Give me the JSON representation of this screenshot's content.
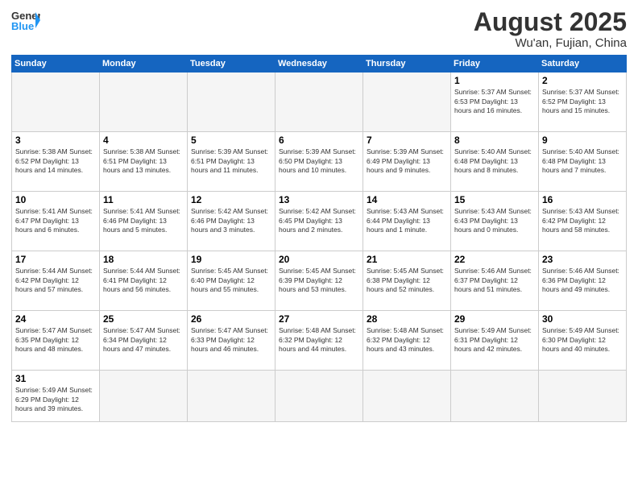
{
  "header": {
    "logo_general": "General",
    "logo_blue": "Blue",
    "title": "August 2025",
    "subtitle": "Wu'an, Fujian, China"
  },
  "days_of_week": [
    "Sunday",
    "Monday",
    "Tuesday",
    "Wednesday",
    "Thursday",
    "Friday",
    "Saturday"
  ],
  "weeks": [
    [
      {
        "day": "",
        "info": ""
      },
      {
        "day": "",
        "info": ""
      },
      {
        "day": "",
        "info": ""
      },
      {
        "day": "",
        "info": ""
      },
      {
        "day": "",
        "info": ""
      },
      {
        "day": "1",
        "info": "Sunrise: 5:37 AM\nSunset: 6:53 PM\nDaylight: 13 hours and 16 minutes."
      },
      {
        "day": "2",
        "info": "Sunrise: 5:37 AM\nSunset: 6:52 PM\nDaylight: 13 hours and 15 minutes."
      }
    ],
    [
      {
        "day": "3",
        "info": "Sunrise: 5:38 AM\nSunset: 6:52 PM\nDaylight: 13 hours and 14 minutes."
      },
      {
        "day": "4",
        "info": "Sunrise: 5:38 AM\nSunset: 6:51 PM\nDaylight: 13 hours and 13 minutes."
      },
      {
        "day": "5",
        "info": "Sunrise: 5:39 AM\nSunset: 6:51 PM\nDaylight: 13 hours and 11 minutes."
      },
      {
        "day": "6",
        "info": "Sunrise: 5:39 AM\nSunset: 6:50 PM\nDaylight: 13 hours and 10 minutes."
      },
      {
        "day": "7",
        "info": "Sunrise: 5:39 AM\nSunset: 6:49 PM\nDaylight: 13 hours and 9 minutes."
      },
      {
        "day": "8",
        "info": "Sunrise: 5:40 AM\nSunset: 6:48 PM\nDaylight: 13 hours and 8 minutes."
      },
      {
        "day": "9",
        "info": "Sunrise: 5:40 AM\nSunset: 6:48 PM\nDaylight: 13 hours and 7 minutes."
      }
    ],
    [
      {
        "day": "10",
        "info": "Sunrise: 5:41 AM\nSunset: 6:47 PM\nDaylight: 13 hours and 6 minutes."
      },
      {
        "day": "11",
        "info": "Sunrise: 5:41 AM\nSunset: 6:46 PM\nDaylight: 13 hours and 5 minutes."
      },
      {
        "day": "12",
        "info": "Sunrise: 5:42 AM\nSunset: 6:46 PM\nDaylight: 13 hours and 3 minutes."
      },
      {
        "day": "13",
        "info": "Sunrise: 5:42 AM\nSunset: 6:45 PM\nDaylight: 13 hours and 2 minutes."
      },
      {
        "day": "14",
        "info": "Sunrise: 5:43 AM\nSunset: 6:44 PM\nDaylight: 13 hours and 1 minute."
      },
      {
        "day": "15",
        "info": "Sunrise: 5:43 AM\nSunset: 6:43 PM\nDaylight: 13 hours and 0 minutes."
      },
      {
        "day": "16",
        "info": "Sunrise: 5:43 AM\nSunset: 6:42 PM\nDaylight: 12 hours and 58 minutes."
      }
    ],
    [
      {
        "day": "17",
        "info": "Sunrise: 5:44 AM\nSunset: 6:42 PM\nDaylight: 12 hours and 57 minutes."
      },
      {
        "day": "18",
        "info": "Sunrise: 5:44 AM\nSunset: 6:41 PM\nDaylight: 12 hours and 56 minutes."
      },
      {
        "day": "19",
        "info": "Sunrise: 5:45 AM\nSunset: 6:40 PM\nDaylight: 12 hours and 55 minutes."
      },
      {
        "day": "20",
        "info": "Sunrise: 5:45 AM\nSunset: 6:39 PM\nDaylight: 12 hours and 53 minutes."
      },
      {
        "day": "21",
        "info": "Sunrise: 5:45 AM\nSunset: 6:38 PM\nDaylight: 12 hours and 52 minutes."
      },
      {
        "day": "22",
        "info": "Sunrise: 5:46 AM\nSunset: 6:37 PM\nDaylight: 12 hours and 51 minutes."
      },
      {
        "day": "23",
        "info": "Sunrise: 5:46 AM\nSunset: 6:36 PM\nDaylight: 12 hours and 49 minutes."
      }
    ],
    [
      {
        "day": "24",
        "info": "Sunrise: 5:47 AM\nSunset: 6:35 PM\nDaylight: 12 hours and 48 minutes."
      },
      {
        "day": "25",
        "info": "Sunrise: 5:47 AM\nSunset: 6:34 PM\nDaylight: 12 hours and 47 minutes."
      },
      {
        "day": "26",
        "info": "Sunrise: 5:47 AM\nSunset: 6:33 PM\nDaylight: 12 hours and 46 minutes."
      },
      {
        "day": "27",
        "info": "Sunrise: 5:48 AM\nSunset: 6:32 PM\nDaylight: 12 hours and 44 minutes."
      },
      {
        "day": "28",
        "info": "Sunrise: 5:48 AM\nSunset: 6:32 PM\nDaylight: 12 hours and 43 minutes."
      },
      {
        "day": "29",
        "info": "Sunrise: 5:49 AM\nSunset: 6:31 PM\nDaylight: 12 hours and 42 minutes."
      },
      {
        "day": "30",
        "info": "Sunrise: 5:49 AM\nSunset: 6:30 PM\nDaylight: 12 hours and 40 minutes."
      }
    ],
    [
      {
        "day": "31",
        "info": "Sunrise: 5:49 AM\nSunset: 6:29 PM\nDaylight: 12 hours and 39 minutes."
      },
      {
        "day": "",
        "info": ""
      },
      {
        "day": "",
        "info": ""
      },
      {
        "day": "",
        "info": ""
      },
      {
        "day": "",
        "info": ""
      },
      {
        "day": "",
        "info": ""
      },
      {
        "day": "",
        "info": ""
      }
    ]
  ]
}
